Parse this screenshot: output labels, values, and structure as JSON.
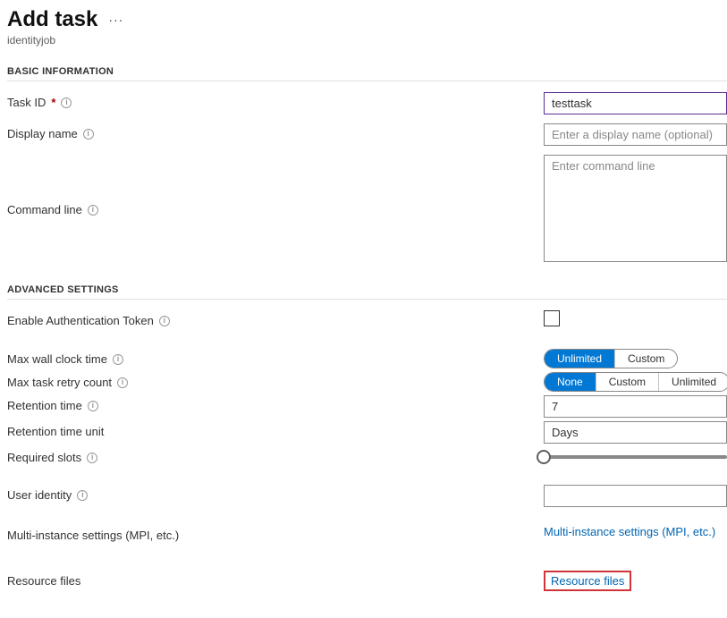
{
  "header": {
    "title": "Add task",
    "subtitle": "identityjob"
  },
  "sections": {
    "basic": "BASIC INFORMATION",
    "advanced": "ADVANCED SETTINGS"
  },
  "labels": {
    "task_id": "Task ID",
    "display_name": "Display name",
    "command_line": "Command line",
    "enable_auth": "Enable Authentication Token",
    "max_wall_clock": "Max wall clock time",
    "max_retry": "Max task retry count",
    "retention_time": "Retention time",
    "retention_unit": "Retention time unit",
    "required_slots": "Required slots",
    "user_identity": "User identity",
    "multi_instance": "Multi-instance settings (MPI, etc.)",
    "resource_files": "Resource files"
  },
  "fields": {
    "task_id_value": "testtask",
    "display_name_placeholder": "Enter a display name (optional)",
    "command_line_placeholder": "Enter command line",
    "retention_time_value": "7",
    "retention_unit_value": "Days",
    "user_identity_value": ""
  },
  "pills": {
    "wall_clock": {
      "opt1": "Unlimited",
      "opt2": "Custom",
      "active": 0
    },
    "retry": {
      "opt1": "None",
      "opt2": "Custom",
      "opt3": "Unlimited",
      "active": 0
    }
  },
  "links": {
    "multi_instance": "Multi-instance settings (MPI, etc.)",
    "resource_files": "Resource files"
  },
  "glyphs": {
    "info": "i",
    "req": "*",
    "more": "···"
  }
}
